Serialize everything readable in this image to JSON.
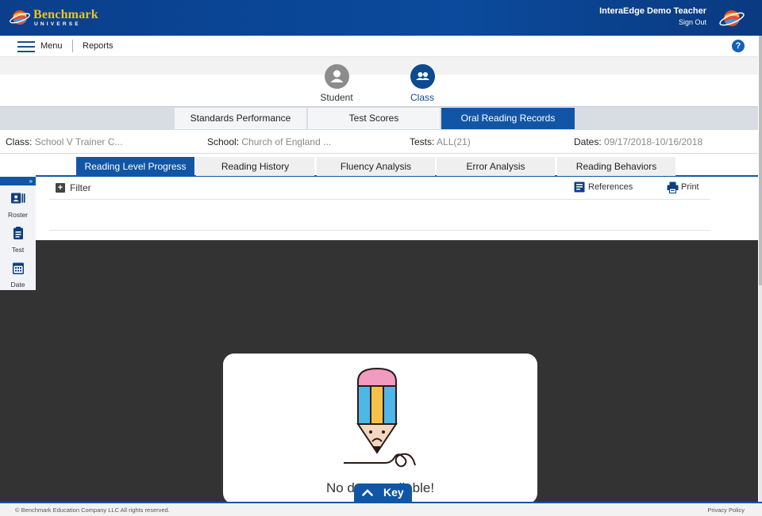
{
  "app": {
    "logo_text": "Benchmark",
    "logo_sub": "UNIVERSE"
  },
  "header": {
    "user_name": "InteraEdge Demo Teacher",
    "sign_out": "Sign Out"
  },
  "menubar": {
    "menu_label": "Menu",
    "reports_label": "Reports",
    "help_glyph": "?"
  },
  "view_toggles": [
    {
      "label": "Student",
      "icon": "person-icon",
      "active": false
    },
    {
      "label": "Class",
      "icon": "group-icon",
      "active": true
    }
  ],
  "report_tabs": [
    {
      "label": "Standards Performance",
      "active": false
    },
    {
      "label": "Test Scores",
      "active": false
    },
    {
      "label": "Oral Reading Records",
      "active": true
    }
  ],
  "info": {
    "class_key": "Class:",
    "class_value": "School V Trainer C...",
    "school_key": "School:",
    "school_value": "Church of England ...",
    "tests_key": "Tests:",
    "tests_value": "ALL(21)",
    "dates_key": "Dates:",
    "dates_value": "09/17/2018-10/16/2018"
  },
  "sub_tabs": [
    {
      "label": "Reading Level Progress",
      "active": true
    },
    {
      "label": "Reading History",
      "active": false
    },
    {
      "label": "Fluency Analysis",
      "active": false
    },
    {
      "label": "Error Analysis",
      "active": false
    },
    {
      "label": "Reading Behaviors",
      "active": false
    }
  ],
  "side_panel": {
    "collapse_glyph": "»",
    "items": [
      {
        "label": "Roster",
        "icon": "roster-icon"
      },
      {
        "label": "Test",
        "icon": "clipboard-icon"
      },
      {
        "label": "Date",
        "icon": "calendar-icon"
      }
    ]
  },
  "toolbar": {
    "filter_label": "Filter",
    "references_label": "References",
    "print_label": "Print"
  },
  "empty_state": {
    "message": "No data available!",
    "icon": "sad-pencil-icon"
  },
  "key_button": {
    "label": "Key"
  },
  "footer": {
    "copyright": "© Benchmark Education Company LLC All rights reserved.",
    "privacy": "Privacy Policy"
  },
  "colors": {
    "header_blue": "#0b4a9c",
    "accent_blue": "#1156a6",
    "logo_gold": "#f5c21b",
    "overlay": "#333333"
  }
}
